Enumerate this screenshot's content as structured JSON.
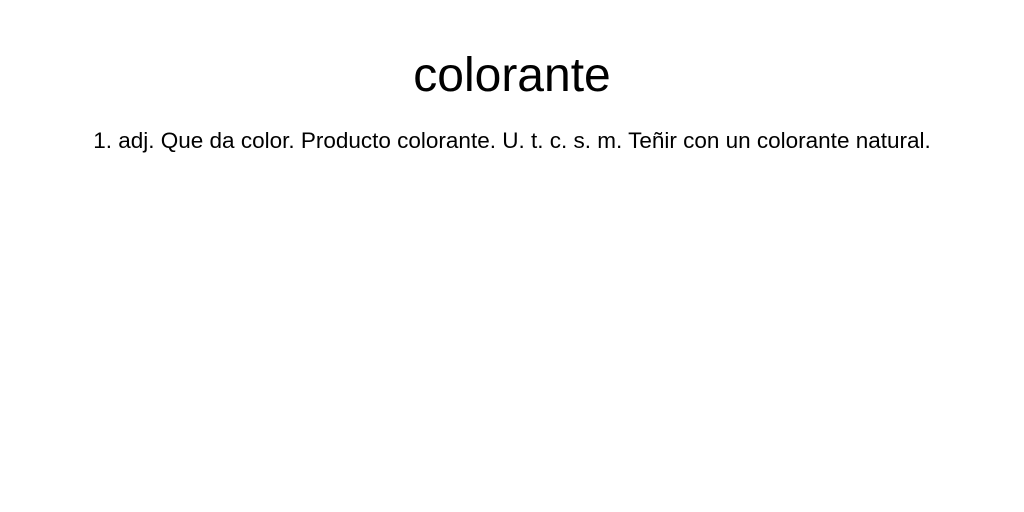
{
  "entry": {
    "word": "colorante",
    "definition": "1. adj. Que da color. Producto colorante. U. t. c. s. m. Teñir con un colorante natural."
  }
}
